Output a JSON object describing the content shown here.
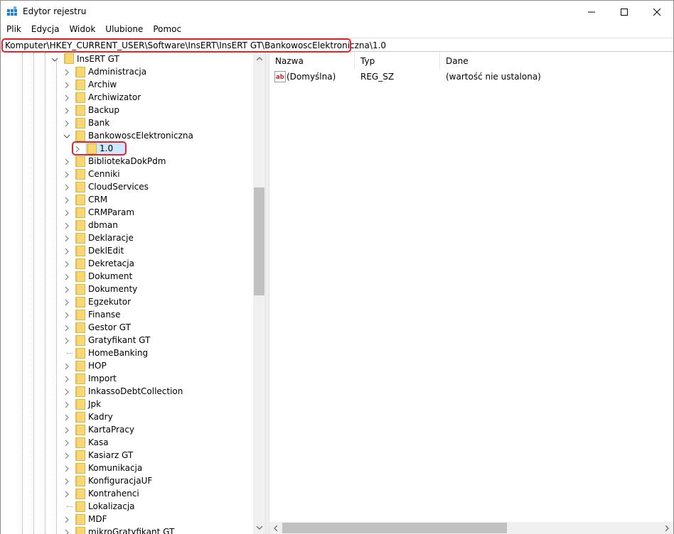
{
  "window": {
    "title": "Edytor rejestru"
  },
  "menu": {
    "items": [
      {
        "label": "Plik"
      },
      {
        "label": "Edycja"
      },
      {
        "label": "Widok"
      },
      {
        "label": "Ulubione"
      },
      {
        "label": "Pomoc"
      }
    ]
  },
  "address": {
    "path": "Komputer\\HKEY_CURRENT_USER\\Software\\InsERT\\InsERT GT\\BankowoscElektroniczna\\1.0"
  },
  "tree": {
    "root": {
      "label": "InsERT GT",
      "state": "expanded"
    },
    "items": [
      {
        "label": "Administracja",
        "level": 1,
        "expander": "collapsed"
      },
      {
        "label": "Archiw",
        "level": 1,
        "expander": "collapsed"
      },
      {
        "label": "Archiwizator",
        "level": 1,
        "expander": "collapsed"
      },
      {
        "label": "Backup",
        "level": 1,
        "expander": "collapsed"
      },
      {
        "label": "Bank",
        "level": 1,
        "expander": "collapsed"
      },
      {
        "label": "BankowoscElektroniczna",
        "level": 1,
        "expander": "expanded"
      },
      {
        "label": "1.0",
        "level": 2,
        "expander": "collapsed",
        "selected": true
      },
      {
        "label": "BibliotekaDokPdm",
        "level": 1,
        "expander": "collapsed"
      },
      {
        "label": "Cenniki",
        "level": 1,
        "expander": "collapsed"
      },
      {
        "label": "CloudServices",
        "level": 1,
        "expander": "collapsed"
      },
      {
        "label": "CRM",
        "level": 1,
        "expander": "collapsed"
      },
      {
        "label": "CRMParam",
        "level": 1,
        "expander": "collapsed"
      },
      {
        "label": "dbman",
        "level": 1,
        "expander": "collapsed"
      },
      {
        "label": "Deklaracje",
        "level": 1,
        "expander": "collapsed"
      },
      {
        "label": "DeklEdit",
        "level": 1,
        "expander": "collapsed"
      },
      {
        "label": "Dekretacja",
        "level": 1,
        "expander": "collapsed"
      },
      {
        "label": "Dokument",
        "level": 1,
        "expander": "collapsed"
      },
      {
        "label": "Dokumenty",
        "level": 1,
        "expander": "collapsed"
      },
      {
        "label": "Egzekutor",
        "level": 1,
        "expander": "collapsed"
      },
      {
        "label": "Finanse",
        "level": 1,
        "expander": "collapsed"
      },
      {
        "label": "Gestor GT",
        "level": 1,
        "expander": "collapsed"
      },
      {
        "label": "Gratyfikant GT",
        "level": 1,
        "expander": "collapsed"
      },
      {
        "label": "HomeBanking",
        "level": 1,
        "expander": "none"
      },
      {
        "label": "HOP",
        "level": 1,
        "expander": "collapsed"
      },
      {
        "label": "Import",
        "level": 1,
        "expander": "collapsed"
      },
      {
        "label": "InkassoDebtCollection",
        "level": 1,
        "expander": "collapsed"
      },
      {
        "label": "Jpk",
        "level": 1,
        "expander": "collapsed"
      },
      {
        "label": "Kadry",
        "level": 1,
        "expander": "collapsed"
      },
      {
        "label": "KartaPracy",
        "level": 1,
        "expander": "collapsed"
      },
      {
        "label": "Kasa",
        "level": 1,
        "expander": "collapsed"
      },
      {
        "label": "Kasiarz GT",
        "level": 1,
        "expander": "collapsed"
      },
      {
        "label": "Komunikacja",
        "level": 1,
        "expander": "collapsed"
      },
      {
        "label": "KonfiguracjaUF",
        "level": 1,
        "expander": "collapsed"
      },
      {
        "label": "Kontrahenci",
        "level": 1,
        "expander": "collapsed"
      },
      {
        "label": "Lokalizacja",
        "level": 1,
        "expander": "none"
      },
      {
        "label": "MDF",
        "level": 1,
        "expander": "collapsed"
      },
      {
        "label": "mikroGratyfikant GT",
        "level": 1,
        "expander": "collapsed"
      }
    ]
  },
  "list": {
    "columns": [
      {
        "label": "Nazwa"
      },
      {
        "label": "Typ"
      },
      {
        "label": "Dane"
      }
    ],
    "rows": [
      {
        "icon": "string-value-icon",
        "name": "(Domyślna)",
        "type": "REG_SZ",
        "data": "(wartość nie ustalona)"
      }
    ]
  },
  "colors": {
    "highlight_red": "#e0242b",
    "selection_blue": "#cce8ff",
    "folder_yellow": "#f8d775"
  }
}
